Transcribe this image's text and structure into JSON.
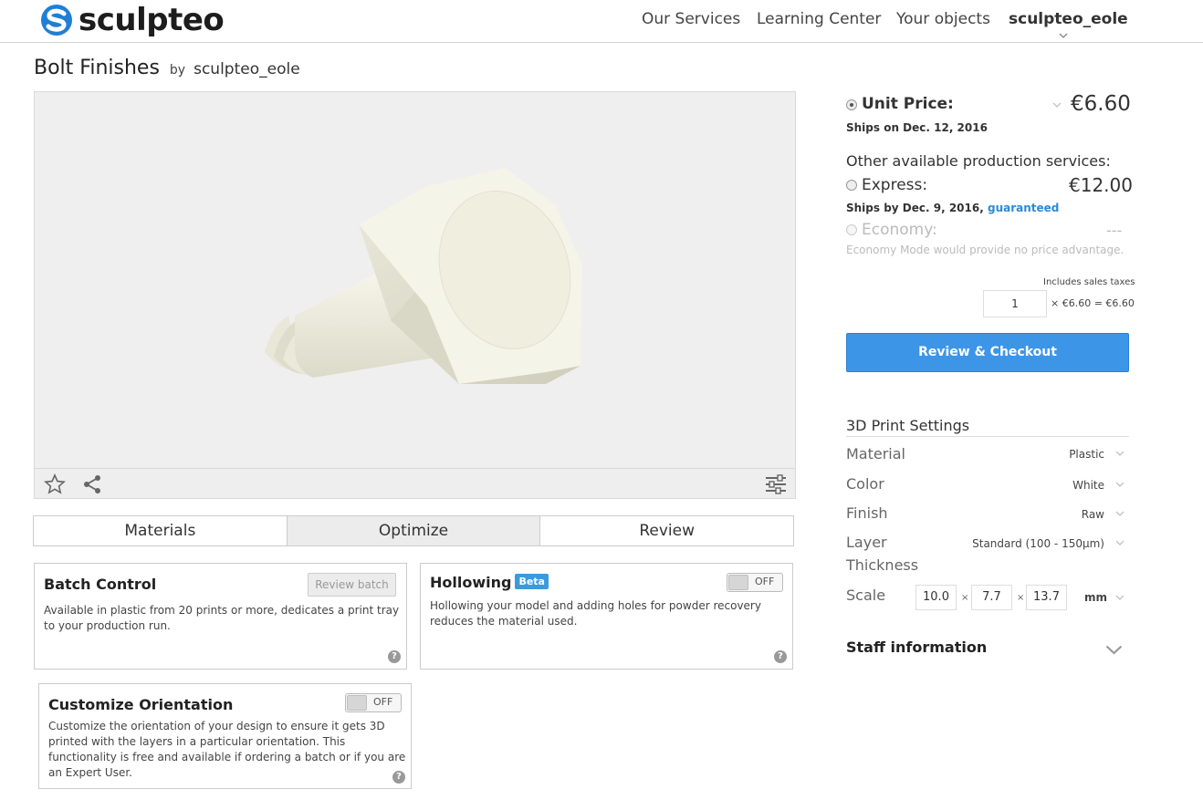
{
  "header": {
    "logo": "sculpteo",
    "nav": [
      "Our Services",
      "Learning Center",
      "Your objects"
    ],
    "user": "sculpteo_eole"
  },
  "object": {
    "title": "Bolt Finishes",
    "by": "by",
    "author": "sculpteo_eole"
  },
  "tabs": [
    {
      "label": "Materials",
      "active": false
    },
    {
      "label": "Optimize",
      "active": true
    },
    {
      "label": "Review",
      "active": false
    }
  ],
  "options": {
    "batch": {
      "title": "Batch Control",
      "button": "Review batch",
      "desc": "Available in plastic from 20 prints or more, dedicates a print tray to your production run."
    },
    "hollowing": {
      "title": "Hollowing",
      "badge": "Beta",
      "toggle": "OFF",
      "desc": "Hollowing your model and adding holes for powder recovery reduces the material used."
    },
    "orientation": {
      "title": "Customize Orientation",
      "toggle": "OFF",
      "desc": "Customize the orientation of your design to ensure it gets 3D printed with the layers in a particular orientation. This functionality is free and available if ordering a batch or if you are an Expert User."
    },
    "help": "?"
  },
  "pricing": {
    "unit_label": "Unit Price:",
    "unit_price": "€6.60",
    "unit_ships": "Ships on Dec. 12, 2016",
    "other_label": "Other available production services:",
    "express_label": "Express:",
    "express_price": "€12.00",
    "express_ships": "Ships by Dec. 9, 2016,",
    "express_guaranteed": "guaranteed",
    "economy_label": "Economy:",
    "economy_price": "---",
    "economy_note": "Economy Mode would provide no price advantage.",
    "taxes": "Includes sales taxes",
    "quantity": "1",
    "total": "× €6.60 = €6.60",
    "checkout": "Review & Checkout"
  },
  "settings": {
    "heading": "3D Print Settings",
    "material_label": "Material",
    "material": "Plastic",
    "color_label": "Color",
    "color": "White",
    "finish_label": "Finish",
    "finish": "Raw",
    "layer_label_1": "Layer",
    "layer_label_2": "Thickness",
    "layer": "Standard (100 - 150µm)",
    "scale_label": "Scale",
    "scale_x": "10.0",
    "scale_y": "7.7",
    "scale_z": "13.7",
    "scale_sep": "×",
    "unit": "mm"
  },
  "staff": {
    "label": "Staff information"
  },
  "colors": {
    "accent": "#3d95e8",
    "model": "#f3f1e4"
  }
}
